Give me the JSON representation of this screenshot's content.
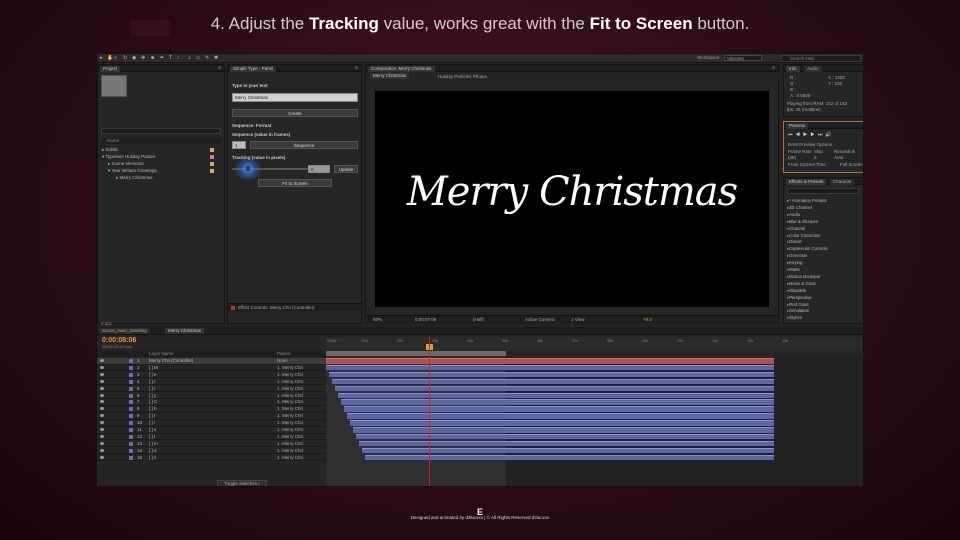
{
  "caption": {
    "prefix": "4. Adjust the ",
    "bold1": "Tracking",
    "mid": " value, works great with the ",
    "bold2": "Fit to Screen",
    "suffix": " button."
  },
  "toolbar": {
    "workspace_label": "Workspace:",
    "workspace_value": "VDcoms",
    "search_placeholder": "Search Help"
  },
  "project": {
    "tab": "Project",
    "col_name": "Name",
    "items": [
      {
        "name": "Solids",
        "color": "#d8b040"
      },
      {
        "name": "Typeface Holiday Parties",
        "color": "#d8b040"
      },
      {
        "name": "Scene elements",
        "color": "#d8b040"
      },
      {
        "name": "Year Written Greetings",
        "color": "#d8b040"
      },
      {
        "name": "Merry Christmas",
        "color": "#d8b040"
      }
    ]
  },
  "simple_type": {
    "tab": "Simple Type - Panel",
    "type_label": "Type in your text",
    "text_value": "Merry Christmas",
    "create": "Create",
    "sequence_title": "Sequence: Format",
    "sequence_label": "Sequence (value in frames)",
    "sequence_value": "1",
    "sequence_btn": "Sequence",
    "tracking_label": "Tracking (value in pixels)",
    "tracking_value": "0",
    "update_btn": "Update",
    "fit_btn": "Fit to Screen",
    "effect_controls": "Effect Controls: Merry Chri (Controller)"
  },
  "comp": {
    "tab": "Composition: Merry Christmas",
    "sub_tab": "Merry Christmas",
    "breadcrumb": "Holiday Particles Photos",
    "viewer_text": "Merry Christmas",
    "zoom": "50%",
    "timecode": "0:00:07:06",
    "resolution": "(Half)",
    "camera": "Active Camera",
    "views": "1 View",
    "offset": "+0.0"
  },
  "info": {
    "tab_info": "Info",
    "tab_audio": "Audio",
    "r": "R :",
    "g": "G :",
    "b": "B :",
    "a": "A : 0.0000",
    "x": "X : 1428",
    "y": "Y : 220",
    "playing1": "Playing from RAM: 152 of 152",
    "playing2": "fps: 25 (realtime)"
  },
  "preview": {
    "tab": "Preview",
    "ram_options": "RAM Preview Options",
    "frame_rate": "Frame Rate",
    "skip": "Skip",
    "resolution": "Resolution",
    "fr_value": "(25)",
    "skip_value": "0",
    "res_value": "Auto",
    "from_current": "From Current Time",
    "full_screen": "Full Screen"
  },
  "effects": {
    "tab": "Effects & Presets",
    "tab2": "Characte",
    "items": [
      "* Animation Presets",
      "3D Channel",
      "Audio",
      "Blur & Sharpen",
      "Channel",
      "Color Correction",
      "Distort",
      "Expression Controls",
      "Generate",
      "Keying",
      "Matte",
      "Motion Boutique",
      "Noise & Grain",
      "Obsolete",
      "Perspective",
      "Red Giant",
      "Simulation",
      "Stylize"
    ]
  },
  "align": {
    "tab1": "Paragraph",
    "tab2": "Align",
    "align_to": "Align Layers to:",
    "align_value": "Composition",
    "distribute": "Distribute Layers:"
  },
  "timeline": {
    "tab1": "Scene_main_Greeting",
    "tab2": "Merry Christmas",
    "timecode": "0:00:08:06",
    "fps": "00206 (25.00 fps)",
    "col_layer": "Layer Name",
    "col_parent": "Parent",
    "ticks": [
      "0:00s",
      "01s",
      "02s",
      "03s",
      "04s",
      "05s",
      "06s",
      "07s",
      "08s",
      "09s",
      "10s",
      "11s",
      "12s",
      "13s"
    ],
    "layers": [
      {
        "num": "1",
        "name": "Merry Chri [Controller]",
        "parent": "None"
      },
      {
        "num": "2",
        "name": "[ ] M",
        "parent": "1. Merry Chri"
      },
      {
        "num": "3",
        "name": "[ ] e",
        "parent": "1. Merry Chri"
      },
      {
        "num": "4",
        "name": "[ ] r",
        "parent": "1. Merry Chri"
      },
      {
        "num": "5",
        "name": "[ ] r",
        "parent": "1. Merry Chri"
      },
      {
        "num": "6",
        "name": "[ ] y",
        "parent": "1. Merry Chri"
      },
      {
        "num": "7",
        "name": "[ ] C",
        "parent": "1. Merry Chri"
      },
      {
        "num": "8",
        "name": "[ ] h",
        "parent": "1. Merry Chri"
      },
      {
        "num": "9",
        "name": "[ ] r",
        "parent": "1. Merry Chri"
      },
      {
        "num": "10",
        "name": "[ ] i",
        "parent": "1. Merry Chri"
      },
      {
        "num": "11",
        "name": "[ ] s",
        "parent": "1. Merry Chri"
      },
      {
        "num": "12",
        "name": "[ ] t",
        "parent": "1. Merry Chri"
      },
      {
        "num": "13",
        "name": "[ ] m",
        "parent": "1. Merry Chri"
      },
      {
        "num": "14",
        "name": "[ ] a",
        "parent": "1. Merry Chri"
      },
      {
        "num": "15",
        "name": "[ ] s",
        "parent": "1. Merry Chri"
      }
    ],
    "toggle": "Toggle Switches / Modes"
  },
  "footer": {
    "logo": "E",
    "text": "Designed and animated by d3lucxxx | © All Rights Reserved d3lucxxx"
  }
}
